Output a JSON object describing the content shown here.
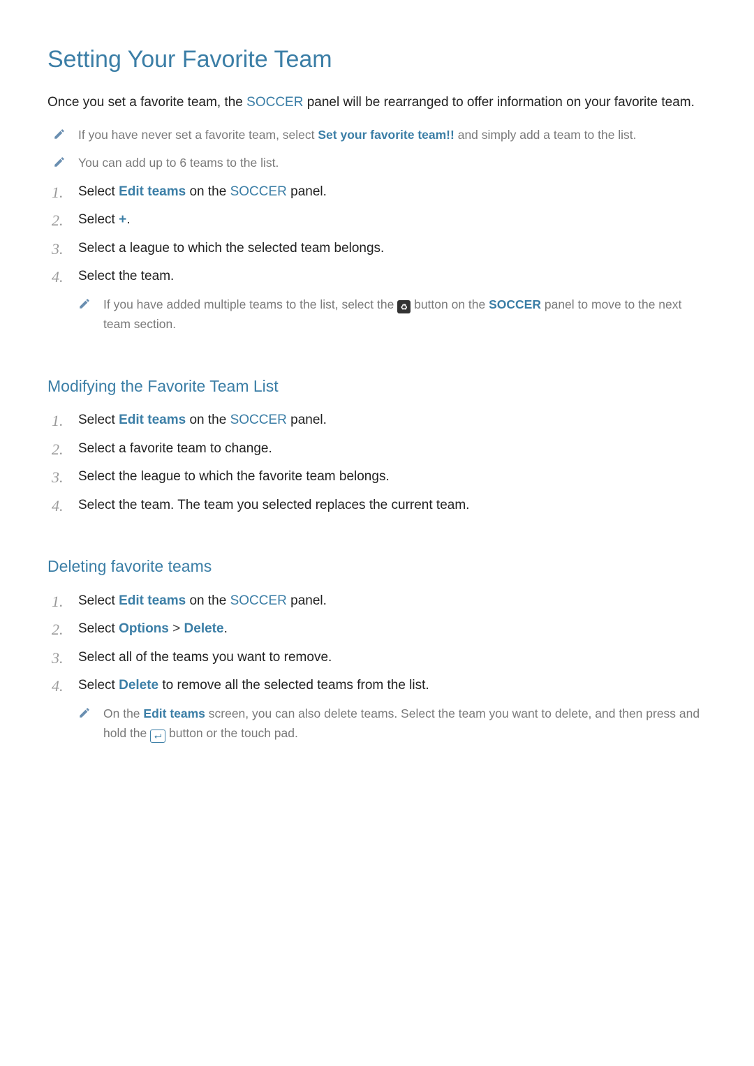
{
  "title": "Setting Your Favorite Team",
  "intro": {
    "t1": "Once you set a favorite team, the ",
    "soccer": "SOCCER",
    "t2": " panel will be rearranged to offer information on your favorite team."
  },
  "intro_notes": [
    {
      "t1": "If you have never set a favorite team, select ",
      "kw": "Set your favorite team!!",
      "t2": " and simply add a team to the list."
    },
    {
      "t1": "You can add up to 6 teams to the list."
    }
  ],
  "section1_steps": [
    {
      "num": "1.",
      "parts": {
        "t1": "Select ",
        "kw1": "Edit teams",
        "t2": " on the ",
        "kw2": "SOCCER",
        "t3": " panel."
      }
    },
    {
      "num": "2.",
      "parts": {
        "t1": "Select ",
        "kw1": "+",
        "t2": "."
      }
    },
    {
      "num": "3.",
      "parts": {
        "t1": "Select a league to which the selected team belongs."
      }
    },
    {
      "num": "4.",
      "parts": {
        "t1": "Select the team."
      }
    }
  ],
  "section1_subnote": {
    "t1": "If you have added multiple teams to the list, select the ",
    "t2": " button on the ",
    "kw": "SOCCER",
    "t3": " panel to move to the next team section."
  },
  "remote_button_label": "♻",
  "section2_title": "Modifying the Favorite Team List",
  "section2_steps": [
    {
      "num": "1.",
      "parts": {
        "t1": "Select ",
        "kw1": "Edit teams",
        "t2": " on the ",
        "kw2": "SOCCER",
        "t3": " panel."
      }
    },
    {
      "num": "2.",
      "parts": {
        "t1": "Select a favorite team to change."
      }
    },
    {
      "num": "3.",
      "parts": {
        "t1": "Select the league to which the favorite team belongs."
      }
    },
    {
      "num": "4.",
      "parts": {
        "t1": "Select the team. The team you selected replaces the current team."
      }
    }
  ],
  "section3_title": "Deleting favorite teams",
  "section3_steps": [
    {
      "num": "1.",
      "parts": {
        "t1": "Select ",
        "kw1": "Edit teams",
        "t2": " on the ",
        "kw2": "SOCCER",
        "t3": " panel."
      }
    },
    {
      "num": "2.",
      "parts": {
        "t1": "Select ",
        "kw1": "Options",
        "gt": " > ",
        "kw2": "Delete",
        "t2": "."
      }
    },
    {
      "num": "3.",
      "parts": {
        "t1": "Select all of the teams you want to remove."
      }
    },
    {
      "num": "4.",
      "parts": {
        "t1": "Select ",
        "kw1": "Delete",
        "t2": " to remove all the selected teams from the list."
      }
    }
  ],
  "section3_subnote": {
    "t1": "On the ",
    "kw": "Edit teams",
    "t2": " screen, you can also delete teams. Select the team you want to delete, and then press and hold the ",
    "t3": " button or the touch pad."
  },
  "enter_button_label": "⮠"
}
